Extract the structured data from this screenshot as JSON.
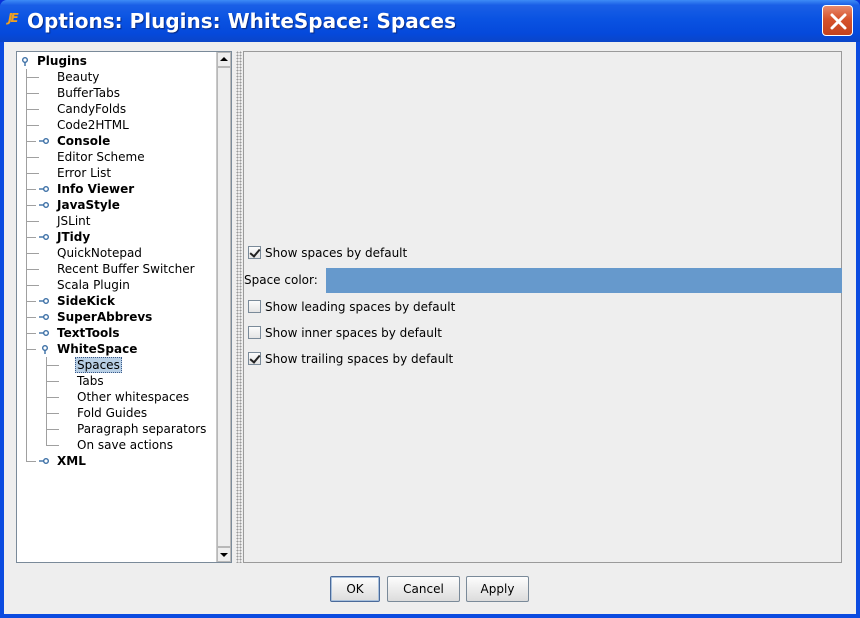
{
  "window": {
    "title": "Options: Plugins: WhiteSpace: Spaces",
    "icon": "jedit-icon"
  },
  "tree": {
    "items": [
      {
        "label": "Plugins",
        "level": 0,
        "bold": true,
        "expanded": true
      },
      {
        "label": "Beauty",
        "level": 1,
        "bold": false
      },
      {
        "label": "BufferTabs",
        "level": 1,
        "bold": false
      },
      {
        "label": "CandyFolds",
        "level": 1,
        "bold": false
      },
      {
        "label": "Code2HTML",
        "level": 1,
        "bold": false
      },
      {
        "label": "Console",
        "level": 1,
        "bold": true,
        "expanded": false
      },
      {
        "label": "Editor Scheme",
        "level": 1,
        "bold": false
      },
      {
        "label": "Error List",
        "level": 1,
        "bold": false
      },
      {
        "label": "Info Viewer",
        "level": 1,
        "bold": true,
        "expanded": false
      },
      {
        "label": "JavaStyle",
        "level": 1,
        "bold": true,
        "expanded": false
      },
      {
        "label": "JSLint",
        "level": 1,
        "bold": false
      },
      {
        "label": "JTidy",
        "level": 1,
        "bold": true,
        "expanded": false
      },
      {
        "label": "QuickNotepad",
        "level": 1,
        "bold": false
      },
      {
        "label": "Recent Buffer Switcher",
        "level": 1,
        "bold": false
      },
      {
        "label": "Scala Plugin",
        "level": 1,
        "bold": false
      },
      {
        "label": "SideKick",
        "level": 1,
        "bold": true,
        "expanded": false
      },
      {
        "label": "SuperAbbrevs",
        "level": 1,
        "bold": true,
        "expanded": false
      },
      {
        "label": "TextTools",
        "level": 1,
        "bold": true,
        "expanded": false
      },
      {
        "label": "WhiteSpace",
        "level": 1,
        "bold": true,
        "expanded": true
      },
      {
        "label": "Spaces",
        "level": 2,
        "bold": false,
        "selected": true
      },
      {
        "label": "Tabs",
        "level": 2,
        "bold": false
      },
      {
        "label": "Other whitespaces",
        "level": 2,
        "bold": false
      },
      {
        "label": "Fold Guides",
        "level": 2,
        "bold": false
      },
      {
        "label": "Paragraph separators",
        "level": 2,
        "bold": false
      },
      {
        "label": "On save actions",
        "level": 2,
        "bold": false
      },
      {
        "label": "XML",
        "level": 1,
        "bold": true,
        "expanded": false
      }
    ]
  },
  "options": {
    "show_spaces": {
      "label": "Show spaces by default",
      "checked": true
    },
    "space_color": {
      "label": "Space color:",
      "color": "#6699cc"
    },
    "show_leading": {
      "label": "Show leading spaces by default",
      "checked": false
    },
    "show_inner": {
      "label": "Show inner spaces by default",
      "checked": false
    },
    "show_trailing": {
      "label": "Show trailing spaces by default",
      "checked": true
    }
  },
  "buttons": {
    "ok": "OK",
    "cancel": "Cancel",
    "apply": "Apply"
  },
  "colors": {
    "titlebar": "#0a53e2",
    "close": "#d6532c",
    "selection": "#b8cfe5",
    "dialog_bg": "#eeeeee"
  }
}
